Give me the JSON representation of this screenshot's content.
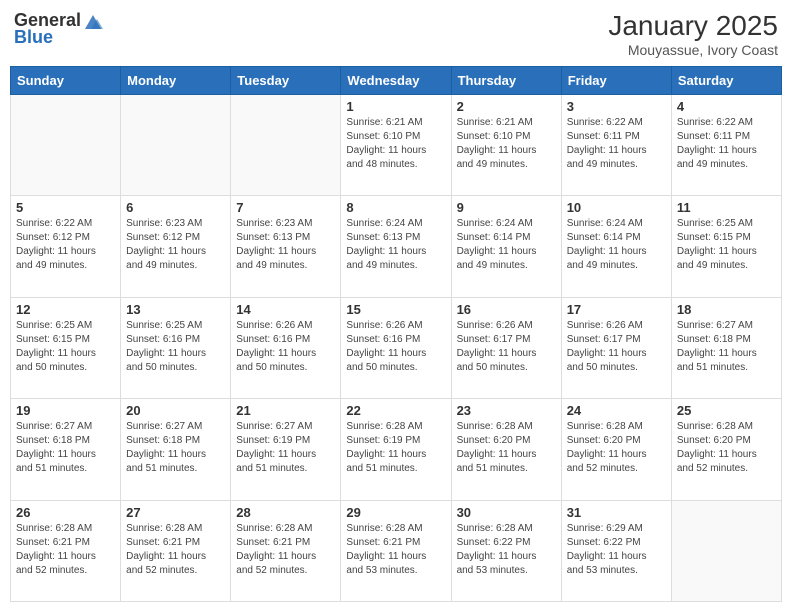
{
  "header": {
    "logo_general": "General",
    "logo_blue": "Blue",
    "title": "January 2025",
    "subtitle": "Mouyassue, Ivory Coast"
  },
  "weekdays": [
    "Sunday",
    "Monday",
    "Tuesday",
    "Wednesday",
    "Thursday",
    "Friday",
    "Saturday"
  ],
  "weeks": [
    [
      {
        "day": "",
        "info": ""
      },
      {
        "day": "",
        "info": ""
      },
      {
        "day": "",
        "info": ""
      },
      {
        "day": "1",
        "info": "Sunrise: 6:21 AM\nSunset: 6:10 PM\nDaylight: 11 hours\nand 48 minutes."
      },
      {
        "day": "2",
        "info": "Sunrise: 6:21 AM\nSunset: 6:10 PM\nDaylight: 11 hours\nand 49 minutes."
      },
      {
        "day": "3",
        "info": "Sunrise: 6:22 AM\nSunset: 6:11 PM\nDaylight: 11 hours\nand 49 minutes."
      },
      {
        "day": "4",
        "info": "Sunrise: 6:22 AM\nSunset: 6:11 PM\nDaylight: 11 hours\nand 49 minutes."
      }
    ],
    [
      {
        "day": "5",
        "info": "Sunrise: 6:22 AM\nSunset: 6:12 PM\nDaylight: 11 hours\nand 49 minutes."
      },
      {
        "day": "6",
        "info": "Sunrise: 6:23 AM\nSunset: 6:12 PM\nDaylight: 11 hours\nand 49 minutes."
      },
      {
        "day": "7",
        "info": "Sunrise: 6:23 AM\nSunset: 6:13 PM\nDaylight: 11 hours\nand 49 minutes."
      },
      {
        "day": "8",
        "info": "Sunrise: 6:24 AM\nSunset: 6:13 PM\nDaylight: 11 hours\nand 49 minutes."
      },
      {
        "day": "9",
        "info": "Sunrise: 6:24 AM\nSunset: 6:14 PM\nDaylight: 11 hours\nand 49 minutes."
      },
      {
        "day": "10",
        "info": "Sunrise: 6:24 AM\nSunset: 6:14 PM\nDaylight: 11 hours\nand 49 minutes."
      },
      {
        "day": "11",
        "info": "Sunrise: 6:25 AM\nSunset: 6:15 PM\nDaylight: 11 hours\nand 49 minutes."
      }
    ],
    [
      {
        "day": "12",
        "info": "Sunrise: 6:25 AM\nSunset: 6:15 PM\nDaylight: 11 hours\nand 50 minutes."
      },
      {
        "day": "13",
        "info": "Sunrise: 6:25 AM\nSunset: 6:16 PM\nDaylight: 11 hours\nand 50 minutes."
      },
      {
        "day": "14",
        "info": "Sunrise: 6:26 AM\nSunset: 6:16 PM\nDaylight: 11 hours\nand 50 minutes."
      },
      {
        "day": "15",
        "info": "Sunrise: 6:26 AM\nSunset: 6:16 PM\nDaylight: 11 hours\nand 50 minutes."
      },
      {
        "day": "16",
        "info": "Sunrise: 6:26 AM\nSunset: 6:17 PM\nDaylight: 11 hours\nand 50 minutes."
      },
      {
        "day": "17",
        "info": "Sunrise: 6:26 AM\nSunset: 6:17 PM\nDaylight: 11 hours\nand 50 minutes."
      },
      {
        "day": "18",
        "info": "Sunrise: 6:27 AM\nSunset: 6:18 PM\nDaylight: 11 hours\nand 51 minutes."
      }
    ],
    [
      {
        "day": "19",
        "info": "Sunrise: 6:27 AM\nSunset: 6:18 PM\nDaylight: 11 hours\nand 51 minutes."
      },
      {
        "day": "20",
        "info": "Sunrise: 6:27 AM\nSunset: 6:18 PM\nDaylight: 11 hours\nand 51 minutes."
      },
      {
        "day": "21",
        "info": "Sunrise: 6:27 AM\nSunset: 6:19 PM\nDaylight: 11 hours\nand 51 minutes."
      },
      {
        "day": "22",
        "info": "Sunrise: 6:28 AM\nSunset: 6:19 PM\nDaylight: 11 hours\nand 51 minutes."
      },
      {
        "day": "23",
        "info": "Sunrise: 6:28 AM\nSunset: 6:20 PM\nDaylight: 11 hours\nand 51 minutes."
      },
      {
        "day": "24",
        "info": "Sunrise: 6:28 AM\nSunset: 6:20 PM\nDaylight: 11 hours\nand 52 minutes."
      },
      {
        "day": "25",
        "info": "Sunrise: 6:28 AM\nSunset: 6:20 PM\nDaylight: 11 hours\nand 52 minutes."
      }
    ],
    [
      {
        "day": "26",
        "info": "Sunrise: 6:28 AM\nSunset: 6:21 PM\nDaylight: 11 hours\nand 52 minutes."
      },
      {
        "day": "27",
        "info": "Sunrise: 6:28 AM\nSunset: 6:21 PM\nDaylight: 11 hours\nand 52 minutes."
      },
      {
        "day": "28",
        "info": "Sunrise: 6:28 AM\nSunset: 6:21 PM\nDaylight: 11 hours\nand 52 minutes."
      },
      {
        "day": "29",
        "info": "Sunrise: 6:28 AM\nSunset: 6:21 PM\nDaylight: 11 hours\nand 53 minutes."
      },
      {
        "day": "30",
        "info": "Sunrise: 6:28 AM\nSunset: 6:22 PM\nDaylight: 11 hours\nand 53 minutes."
      },
      {
        "day": "31",
        "info": "Sunrise: 6:29 AM\nSunset: 6:22 PM\nDaylight: 11 hours\nand 53 minutes."
      },
      {
        "day": "",
        "info": ""
      }
    ]
  ]
}
